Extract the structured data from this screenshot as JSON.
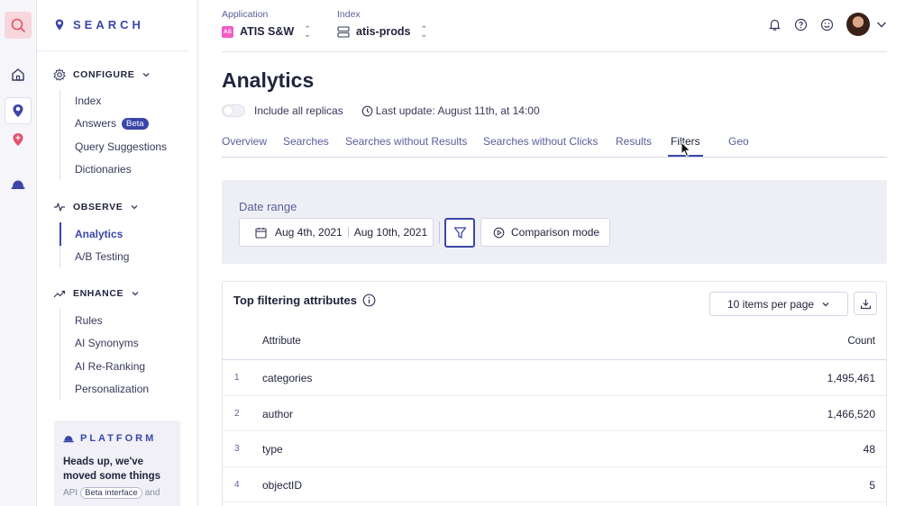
{
  "brand": {
    "name": "SEARCH"
  },
  "sidebar": {
    "configure": {
      "title": "CONFIGURE",
      "items": [
        {
          "label": "Index"
        },
        {
          "label": "Answers",
          "badge": "Beta"
        },
        {
          "label": "Query Suggestions"
        },
        {
          "label": "Dictionaries"
        }
      ]
    },
    "observe": {
      "title": "OBSERVE",
      "items": [
        {
          "label": "Analytics",
          "active": true
        },
        {
          "label": "A/B Testing"
        }
      ]
    },
    "enhance": {
      "title": "ENHANCE",
      "items": [
        {
          "label": "Rules"
        },
        {
          "label": "AI Synonyms"
        },
        {
          "label": "AI Re-Ranking"
        },
        {
          "label": "Personalization"
        }
      ]
    },
    "platform": {
      "title": "PLATFORM",
      "heading": "Heads up, we've moved some things",
      "foot_prefix": "API",
      "chip": "Beta interface",
      "foot_suffix": "and"
    }
  },
  "header": {
    "application": {
      "label": "Application",
      "badge": "AS",
      "value": "ATIS S&W"
    },
    "index": {
      "label": "Index",
      "value": "atis-prods"
    },
    "icons": [
      "bell-icon",
      "help-icon",
      "smiley-icon"
    ]
  },
  "page": {
    "title": "Analytics",
    "replicas_label": "Include all replicas",
    "last_update": "Last update: August 11th, at 14:00"
  },
  "tabs": [
    {
      "label": "Overview"
    },
    {
      "label": "Searches"
    },
    {
      "label": "Searches without Results"
    },
    {
      "label": "Searches without Clicks"
    },
    {
      "label": "Results"
    },
    {
      "label": "Filters",
      "active": true
    },
    {
      "label": "Geo"
    }
  ],
  "date_range": {
    "label": "Date range",
    "start": "Aug 4th, 2021",
    "end": "Aug 10th, 2021",
    "comparison_label": "Comparison mode"
  },
  "table": {
    "title": "Top filtering attributes",
    "per_page": "10 items per page",
    "columns": {
      "attribute": "Attribute",
      "count": "Count"
    },
    "rows": [
      {
        "index": "1",
        "attribute": "categories",
        "count": "1,495,461"
      },
      {
        "index": "2",
        "attribute": "author",
        "count": "1,466,520"
      },
      {
        "index": "3",
        "attribute": "type",
        "count": "48"
      },
      {
        "index": "4",
        "attribute": "objectID",
        "count": "5"
      }
    ]
  },
  "colors": {
    "accent": "#3a46a8",
    "search_highlight": "#f8d7dc",
    "app_badge": "#f25cc5"
  }
}
